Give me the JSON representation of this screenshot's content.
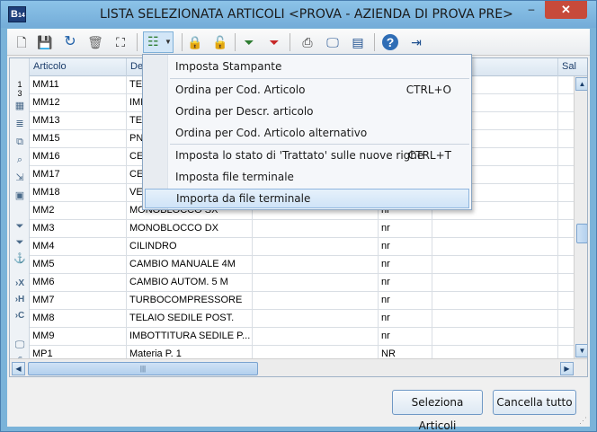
{
  "window": {
    "title": "LISTA SELEZIONATA ARTICOLI <PROVA - AZIENDA DI PROVA PRE>",
    "app_icon_text": "B",
    "app_icon_sub": "14",
    "minimize_glyph": "–",
    "close_glyph": "✕"
  },
  "toolbar": {
    "icons": [
      "new-file-icon",
      "save-icon",
      "refresh-icon",
      "delete-icon",
      "find-icon",
      "list-options-icon",
      "lock-icon",
      "unlock-icon",
      "filter-add-icon",
      "filter-remove-icon",
      "print-icon",
      "monitor-icon",
      "export-icon",
      "help-icon",
      "exit-icon"
    ]
  },
  "grid": {
    "columns": [
      "Articolo",
      "Des",
      "Sal"
    ],
    "row_header_top": "1\n3",
    "rows": [
      {
        "code": "MM11",
        "desc": "TELA",
        "um": ""
      },
      {
        "code": "MM12",
        "desc": "IME",
        "um": ""
      },
      {
        "code": "MM13",
        "desc": "TES",
        "um": ""
      },
      {
        "code": "MM15",
        "desc": "PNE",
        "um": ""
      },
      {
        "code": "MM16",
        "desc": "CER",
        "um": ""
      },
      {
        "code": "MM17",
        "desc": "CER",
        "um": ""
      },
      {
        "code": "MM18",
        "desc": "VER",
        "um": ""
      },
      {
        "code": "MM2",
        "desc": "MONOBLOCCO SX",
        "um": "nr"
      },
      {
        "code": "MM3",
        "desc": "MONOBLOCCO DX",
        "um": "nr"
      },
      {
        "code": "MM4",
        "desc": "CILINDRO",
        "um": "nr"
      },
      {
        "code": "MM5",
        "desc": "CAMBIO MANUALE 4M",
        "um": "nr"
      },
      {
        "code": "MM6",
        "desc": "CAMBIO AUTOM. 5 M",
        "um": "nr"
      },
      {
        "code": "MM7",
        "desc": "TURBOCOMPRESSORE",
        "um": "nr"
      },
      {
        "code": "MM8",
        "desc": "TELAIO SEDILE POST.",
        "um": "nr"
      },
      {
        "code": "MM9",
        "desc": "IMBOTTITURA SEDILE P...",
        "um": "nr"
      },
      {
        "code": "MP1",
        "desc": "Materia P. 1",
        "um": "NR"
      }
    ],
    "hscroll_thumb_glyph": "|||"
  },
  "menu": {
    "items": [
      {
        "label": "Imposta Stampante",
        "shortcut": ""
      },
      {
        "label": "Ordina per Cod. Articolo",
        "shortcut": "CTRL+O"
      },
      {
        "label": "Ordina per Descr. articolo",
        "shortcut": ""
      },
      {
        "label": "Ordina per Cod. Articolo alternativo",
        "shortcut": ""
      },
      {
        "label": "Imposta lo stato di 'Trattato' sulle nuove righe",
        "shortcut": "CTRL+T"
      },
      {
        "label": "Imposta file terminale",
        "shortcut": ""
      },
      {
        "label": "Importa da file terminale",
        "shortcut": ""
      }
    ],
    "highlighted_index": 6
  },
  "buttons": {
    "select": "Seleziona Articoli",
    "cancel_all": "Cancella tutto"
  },
  "colors": {
    "frame": "#7ab3d9",
    "close": "#c74a3a",
    "accent": "#3a6ea5"
  }
}
